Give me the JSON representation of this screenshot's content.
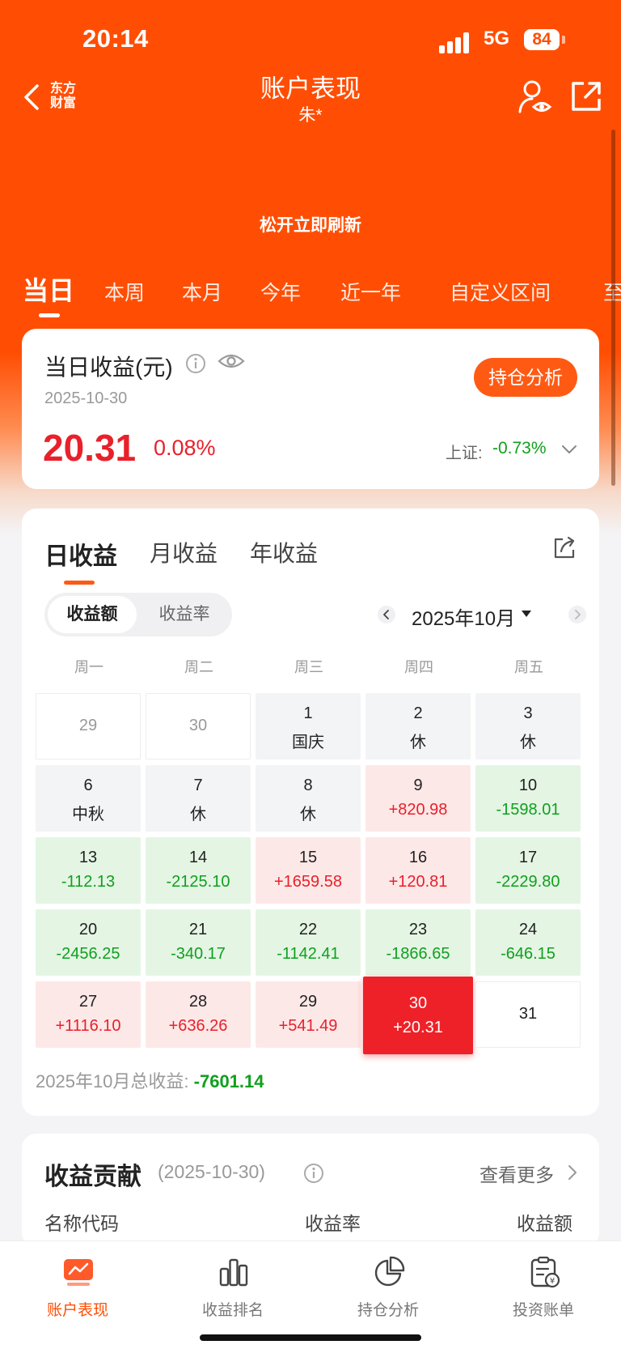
{
  "status_bar": {
    "time": "20:14",
    "network": "5G",
    "battery": "84"
  },
  "nav": {
    "brand_line1": "东方",
    "brand_line2": "财富",
    "title": "账户表现",
    "subtitle": "朱*"
  },
  "refresh_hint": "松开立即刷新",
  "period_tabs": [
    "当日",
    "本周",
    "本月",
    "今年",
    "近一年",
    "自定义区间",
    "至"
  ],
  "summary": {
    "title": "当日收益(元)",
    "date": "2025-10-30",
    "button": "持仓分析",
    "amount": "20.31",
    "rate": "0.08%",
    "index_label": "上证:",
    "index_value": "-0.73%"
  },
  "calendar": {
    "tabs": [
      "日收益",
      "月收益",
      "年收益"
    ],
    "toggle": [
      "收益额",
      "收益率"
    ],
    "month": "2025年10月",
    "weekdays": [
      "周一",
      "周二",
      "周三",
      "周四",
      "周五"
    ],
    "weeks": [
      [
        {
          "day": "29",
          "value": "",
          "kind": "prev"
        },
        {
          "day": "30",
          "value": "",
          "kind": "prev"
        },
        {
          "day": "1",
          "value": "国庆",
          "kind": "off"
        },
        {
          "day": "2",
          "value": "休",
          "kind": "off"
        },
        {
          "day": "3",
          "value": "休",
          "kind": "off"
        }
      ],
      [
        {
          "day": "6",
          "value": "中秋",
          "kind": "off"
        },
        {
          "day": "7",
          "value": "休",
          "kind": "off"
        },
        {
          "day": "8",
          "value": "休",
          "kind": "off"
        },
        {
          "day": "9",
          "value": "+820.98",
          "kind": "up"
        },
        {
          "day": "10",
          "value": "-1598.01",
          "kind": "down"
        }
      ],
      [
        {
          "day": "13",
          "value": "-112.13",
          "kind": "down"
        },
        {
          "day": "14",
          "value": "-2125.10",
          "kind": "down"
        },
        {
          "day": "15",
          "value": "+1659.58",
          "kind": "up"
        },
        {
          "day": "16",
          "value": "+120.81",
          "kind": "up"
        },
        {
          "day": "17",
          "value": "-2229.80",
          "kind": "down"
        }
      ],
      [
        {
          "day": "20",
          "value": "-2456.25",
          "kind": "down"
        },
        {
          "day": "21",
          "value": "-340.17",
          "kind": "down"
        },
        {
          "day": "22",
          "value": "-1142.41",
          "kind": "down"
        },
        {
          "day": "23",
          "value": "-1866.65",
          "kind": "down"
        },
        {
          "day": "24",
          "value": "-646.15",
          "kind": "down"
        }
      ],
      [
        {
          "day": "27",
          "value": "+1116.10",
          "kind": "up"
        },
        {
          "day": "28",
          "value": "+636.26",
          "kind": "up"
        },
        {
          "day": "29",
          "value": "+541.49",
          "kind": "up"
        },
        {
          "day": "30",
          "value": "+20.31",
          "kind": "selected"
        },
        {
          "day": "31",
          "value": "",
          "kind": "future"
        }
      ]
    ],
    "total_label": "2025年10月总收益:",
    "total_value": "-7601.14"
  },
  "contribution": {
    "title": "收益贡献",
    "date": "(2025-10-30)",
    "more": "查看更多",
    "columns": [
      "名称代码",
      "收益率",
      "收益额"
    ]
  },
  "bottom_nav": [
    "账户表现",
    "收益排名",
    "持仓分析",
    "投资账单"
  ],
  "colors": {
    "brand": "#ff4e04",
    "up": "#e8212a",
    "down": "#10a01e"
  }
}
